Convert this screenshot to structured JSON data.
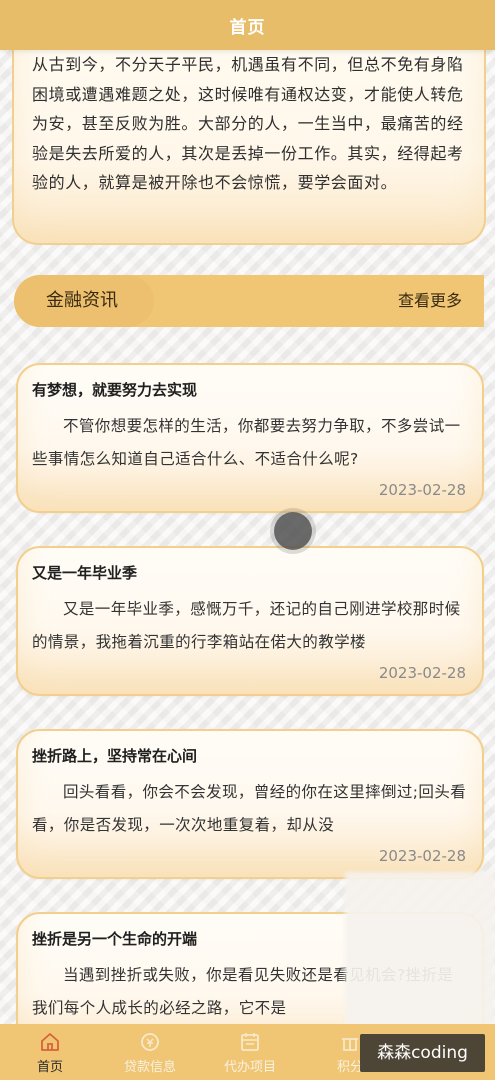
{
  "header": {
    "title": "首页"
  },
  "intro": {
    "text": "从古到今，不分天子平民，机遇虽有不同，但总不免有身陷困境或遭遇难题之处，这时候唯有通权达变，才能使人转危为安，甚至反败为胜。大部分的人，一生当中，最痛苦的经验是失去所爱的人，其次是丢掉一份工作。其实，经得起考验的人，就算是被开除也不会惊慌，要学会面对。"
  },
  "section": {
    "title": "金融资讯",
    "more_label": "查看更多"
  },
  "news": [
    {
      "title": "有梦想，就要努力去实现",
      "body": "不管你想要怎样的生活，你都要去努力争取，不多尝试一些事情怎么知道自己适合什么、不适合什么呢?",
      "date": "2023-02-28"
    },
    {
      "title": "又是一年毕业季",
      "body": "又是一年毕业季，感慨万千，还记的自己刚进学校那时候的情景，我拖着沉重的行李箱站在偌大的教学楼",
      "date": "2023-02-28"
    },
    {
      "title": "挫折路上，坚持常在心间",
      "body": "回头看看，你会不会发现，曾经的你在这里摔倒过;回头看看，你是否发现，一次次地重复着，却从没",
      "date": "2023-02-28"
    },
    {
      "title": "挫折是另一个生命的开端",
      "body": "当遇到挫折或失败，你是看见失败还是看见机会?挫折是我们每个人成长的必经之路，它不是",
      "date": ""
    }
  ],
  "tabbar": {
    "tabs": [
      {
        "label": "首页",
        "icon": "home-icon"
      },
      {
        "label": "贷款信息",
        "icon": "loan-icon"
      },
      {
        "label": "代办项目",
        "icon": "calendar-icon"
      },
      {
        "label": "积分",
        "icon": "points-icon"
      }
    ]
  },
  "watermark": {
    "text": "森森coding"
  },
  "colors": {
    "accent": "#e8bd6a",
    "tabbar": "#f0c675",
    "card_border": "#f3cf8d",
    "active_icon": "#d9623a"
  }
}
